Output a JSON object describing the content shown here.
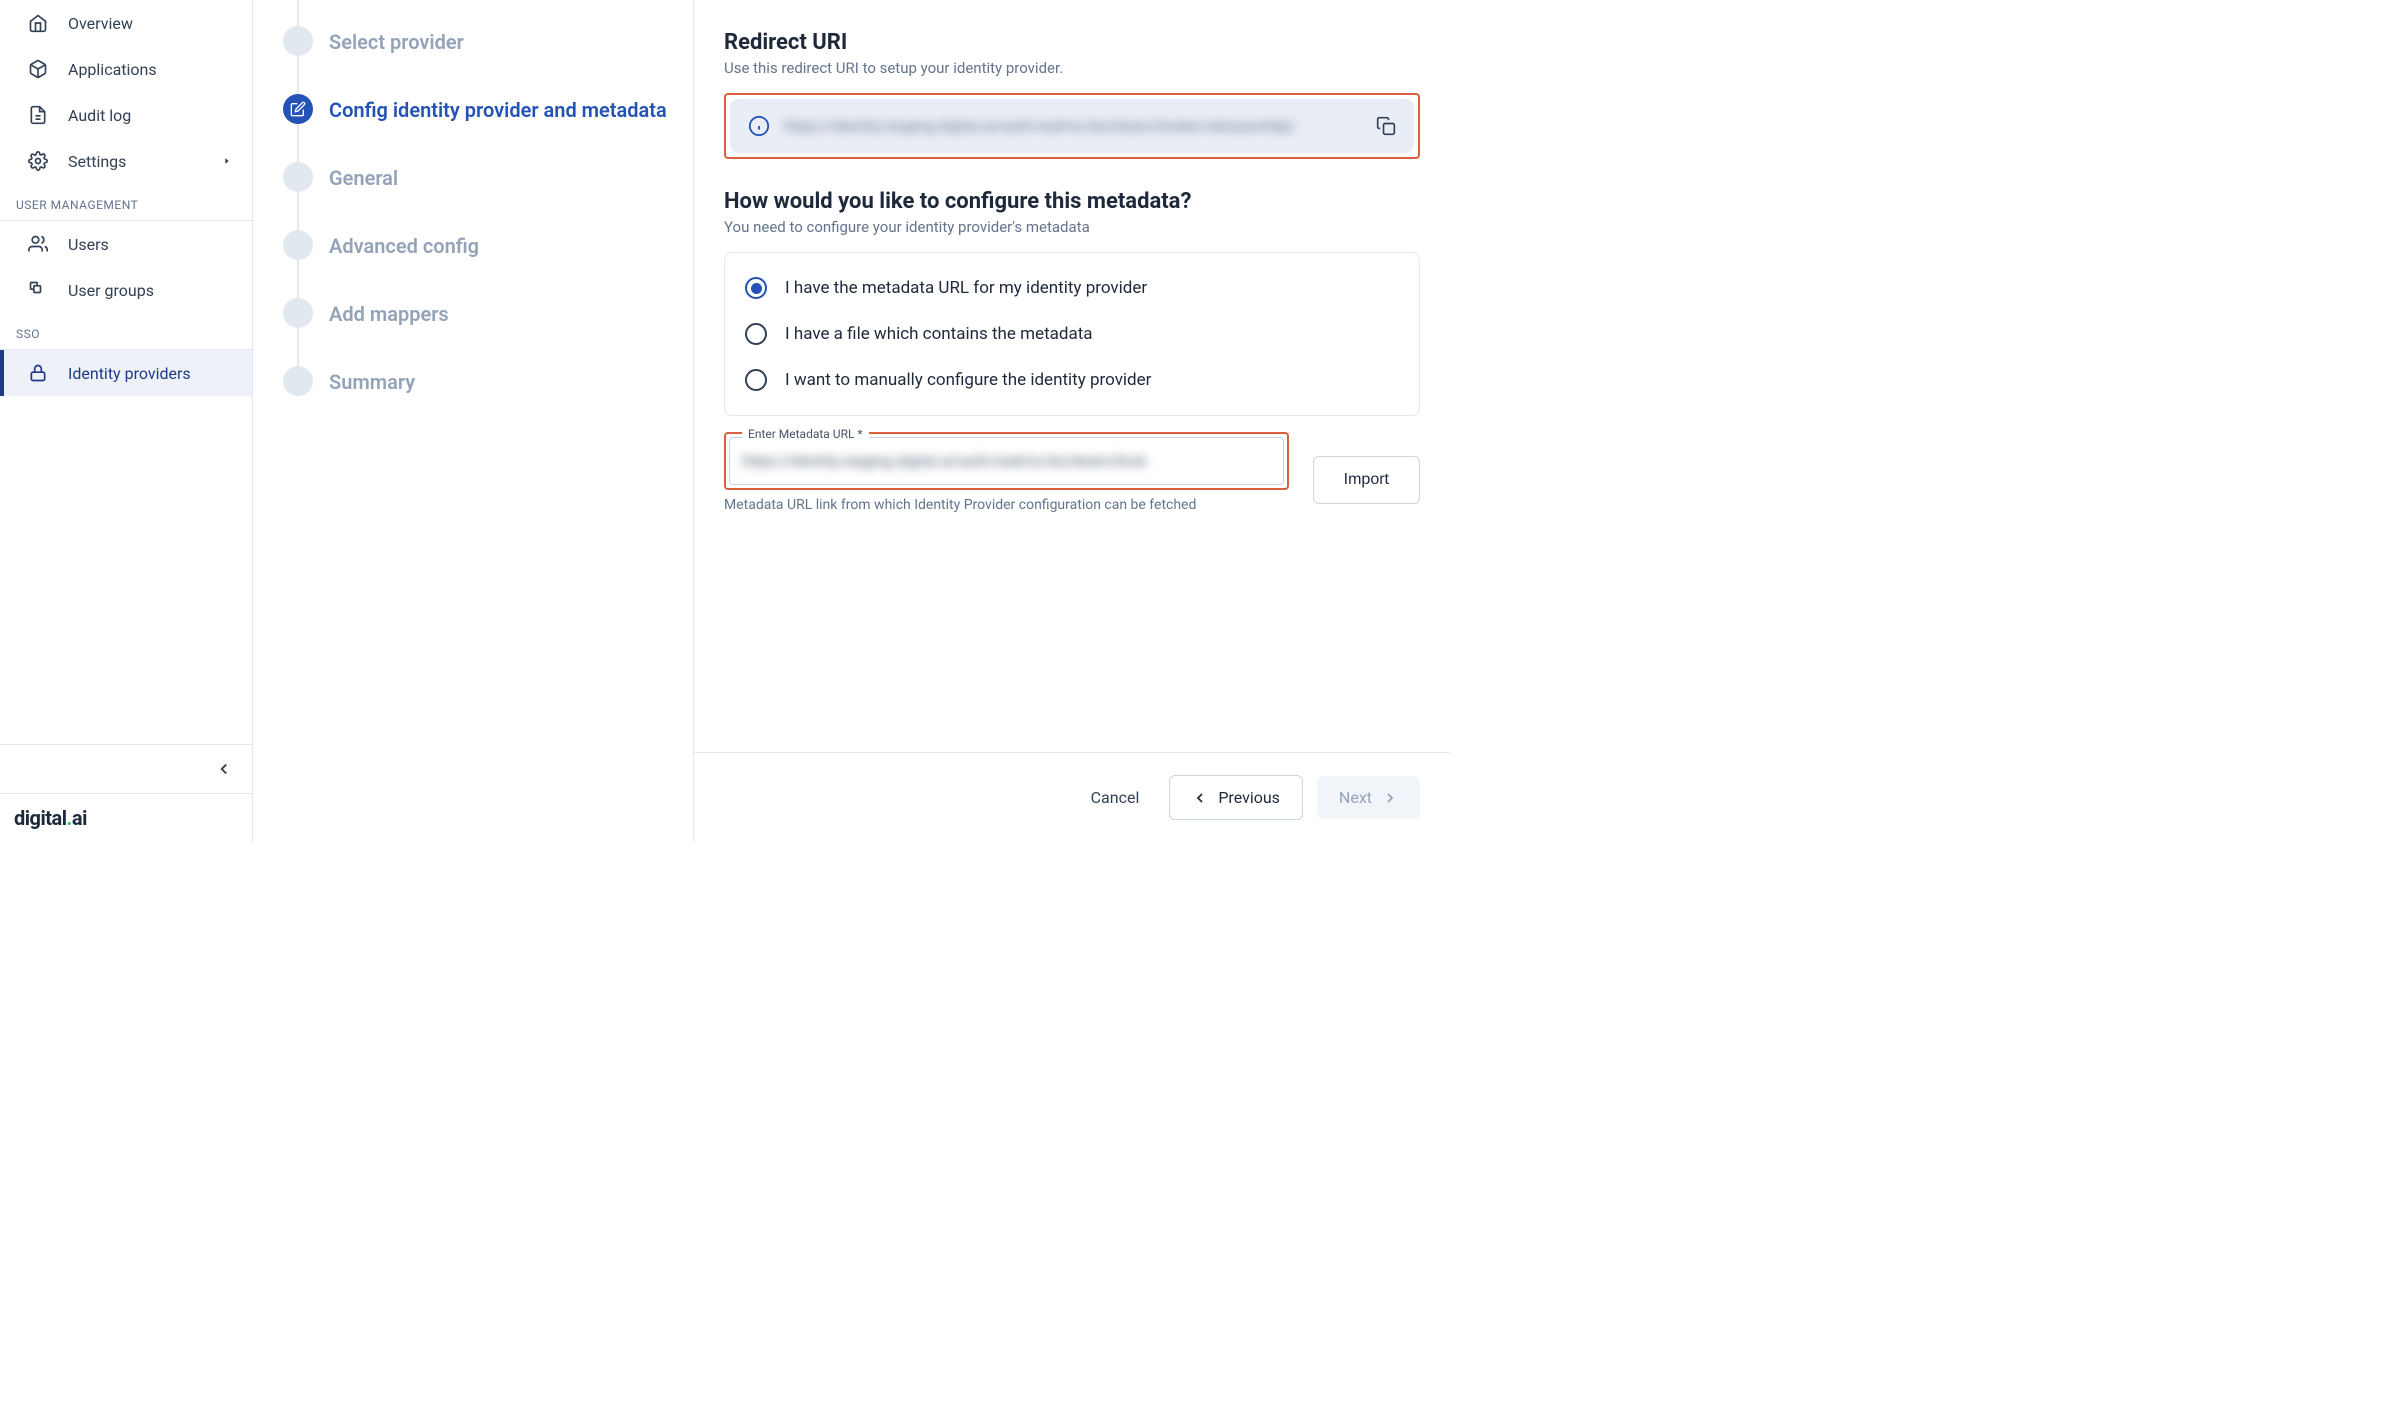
{
  "sidebar": {
    "items": [
      {
        "label": "Overview",
        "icon": "home"
      },
      {
        "label": "Applications",
        "icon": "cube"
      },
      {
        "label": "Audit log",
        "icon": "file"
      },
      {
        "label": "Settings",
        "icon": "gear",
        "expandable": true
      }
    ],
    "section_user_mgmt": "USER MANAGEMENT",
    "user_items": [
      {
        "label": "Users",
        "icon": "users"
      },
      {
        "label": "User groups",
        "icon": "groups"
      }
    ],
    "section_sso": "SSO",
    "sso_items": [
      {
        "label": "Identity providers",
        "icon": "lock",
        "active": true
      }
    ],
    "logo_text": "digital.ai"
  },
  "stepper": {
    "steps": [
      "Select provider",
      "Config identity provider and metadata",
      "General",
      "Advanced config",
      "Add mappers",
      "Summary"
    ],
    "active_index": 1
  },
  "main": {
    "redirect_title": "Redirect URI",
    "redirect_sub": "Use this redirect URI to setup your identity provider.",
    "redirect_value": "https://identity.staging.digital.ai/auth/realms/doctteam/broker/oktasamlidp/",
    "config_title": "How would you like to configure this metadata?",
    "config_sub": "You need to configure your identity provider's metadata",
    "radios": [
      "I have the metadata URL for my identity provider",
      "I have a file which contains the metadata",
      "I want to manually configure the identity provider"
    ],
    "radio_selected": 0,
    "metadata_label": "Enter Metadata URL *",
    "metadata_value": "https://identity.staging.digital.ai/auth/realms/doctteam/brok",
    "metadata_help": "Metadata URL link from which Identity Provider configuration can be fetched",
    "import_label": "Import"
  },
  "footer": {
    "cancel": "Cancel",
    "previous": "Previous",
    "next": "Next"
  }
}
